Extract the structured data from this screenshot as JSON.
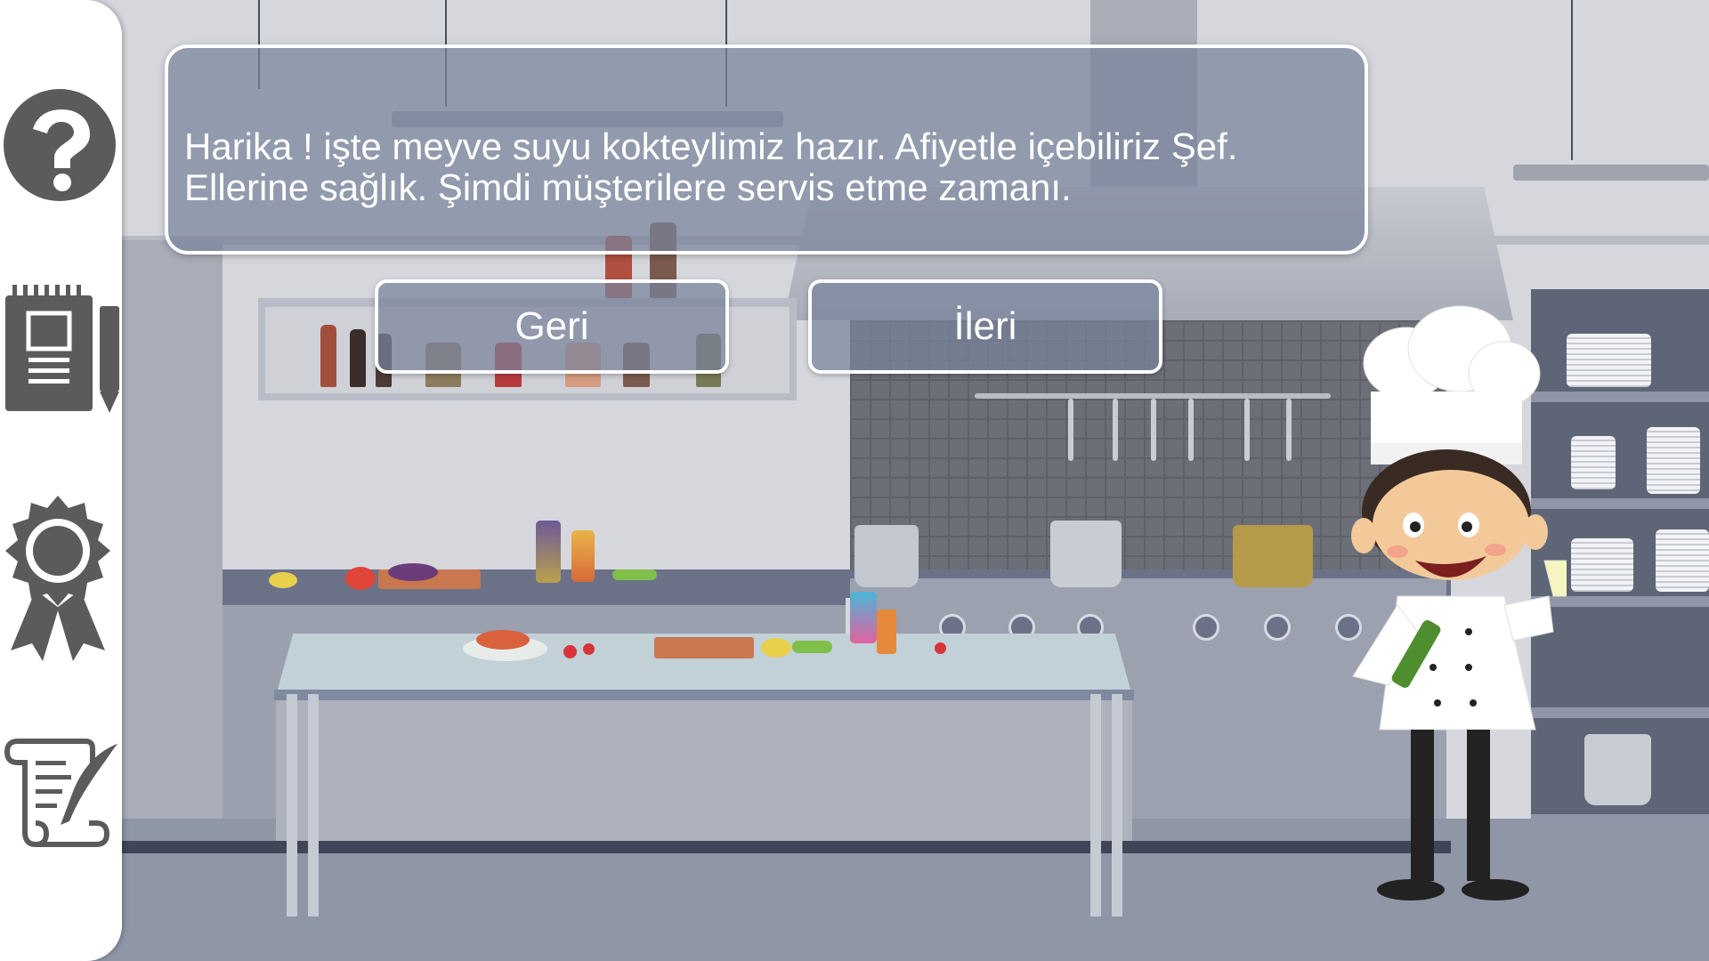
{
  "sidebar": {
    "buttons": [
      {
        "name": "help",
        "icon": "question-mark-icon"
      },
      {
        "name": "notes",
        "icon": "notepad-pencil-icon"
      },
      {
        "name": "achievements",
        "icon": "award-ribbon-icon"
      },
      {
        "name": "script",
        "icon": "scroll-quill-icon"
      }
    ]
  },
  "dialog": {
    "line1": "Harika ! işte meyve suyu kokteylimiz hazır. Afiyetle içebiliriz Şef.",
    "line2": "Ellerine sağlık. Şimdi müşterilere servis etme zamanı."
  },
  "navigation": {
    "back_label": "Geri",
    "next_label": "İleri"
  },
  "colors": {
    "dialog_fill": "#78829b",
    "dialog_border": "#ffffff",
    "sidebar_icon": "#5b5b5b"
  }
}
